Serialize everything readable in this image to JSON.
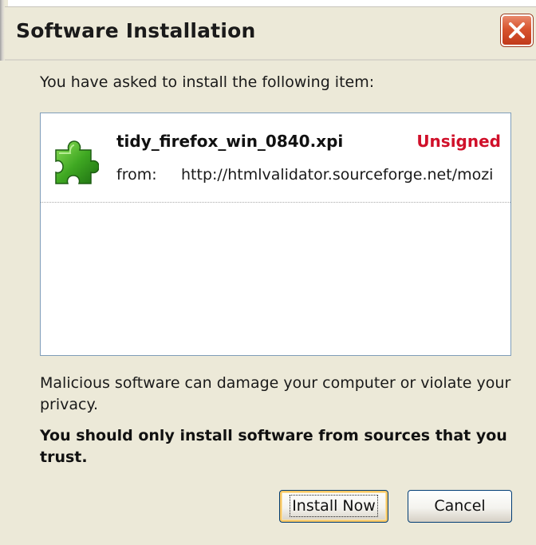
{
  "window": {
    "title": "Software Installation"
  },
  "dialog": {
    "prompt": "You have asked to install the following item:",
    "item": {
      "icon": "puzzle-piece-icon",
      "filename": "tidy_firefox_win_0840.xpi",
      "signature_status": "Unsigned",
      "signature_status_color": "#d0102a",
      "from_label": "from:",
      "from_url": "http://htmlvalidator.sourceforge.net/mozi"
    },
    "warning": "Malicious software can damage your computer or violate your privacy.",
    "trust_notice": "You should only install software from sources that you trust."
  },
  "buttons": {
    "install_label": "Install Now",
    "cancel_label": "Cancel"
  },
  "colors": {
    "dialog_background": "#ece9d8",
    "close_button": "#d8542f",
    "list_border": "#7f9db9",
    "puzzle_green": "#3fa822"
  }
}
